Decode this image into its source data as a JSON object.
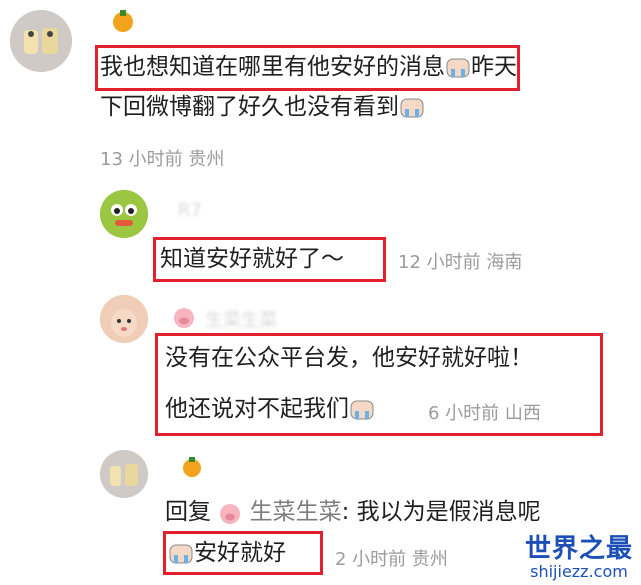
{
  "comments": [
    {
      "text_line1": "我也想知道在哪里有他安好的消息",
      "text_line1_tail": "昨天",
      "text_line2": "下回微博翻了好久也没有看到",
      "meta": "13 小时前  贵州"
    },
    {
      "username": "R7",
      "text": "知道安好就好了～",
      "meta": "12 小时前  海南"
    },
    {
      "username": "生菜生菜",
      "text_line1": "没有在公众平台发，他安好就好啦！",
      "text_line2": "他还说对不起我们",
      "meta": "6 小时前  山西"
    },
    {
      "reply_prefix": "回复",
      "reply_to": "生菜生菜",
      "text": ": 我以为是假消息呢",
      "text_line2": "安好就好",
      "meta": "2 小时前  贵州"
    }
  ],
  "watermark": {
    "title": "世界之最",
    "url": "shijiezz.com"
  },
  "colors": {
    "highlight_box": "#e3202c",
    "meta_text": "#9b9b9b",
    "watermark": "#1c4fb8"
  }
}
